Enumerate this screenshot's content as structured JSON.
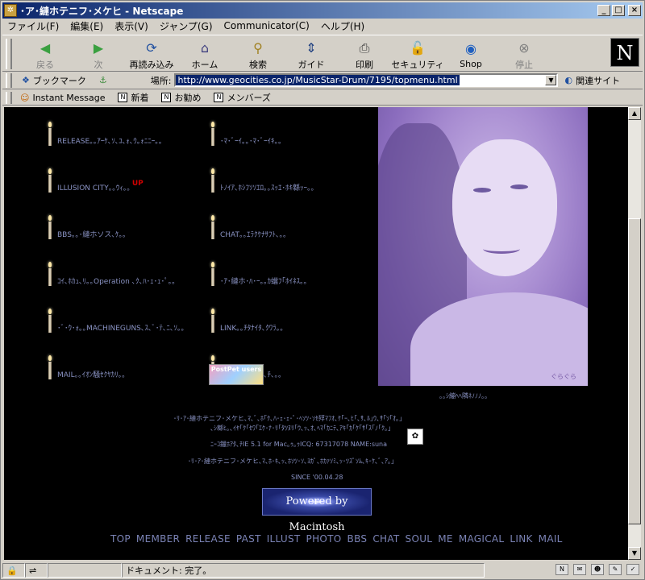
{
  "window": {
    "title": "･ア･縺ホテニフ･メケヒ - Netscape",
    "minimize": "_",
    "maximize": "□",
    "close": "×"
  },
  "menubar": {
    "items": [
      "ファイル(F)",
      "編集(E)",
      "表示(V)",
      "ジャンプ(G)",
      "Communicator(C)",
      "ヘルプ(H)"
    ]
  },
  "navbar": {
    "buttons": [
      {
        "label": "戻る",
        "icon": "back-arrow-icon",
        "glyph": "◀",
        "color": "#3aa040",
        "disabled": true
      },
      {
        "label": "次",
        "icon": "forward-arrow-icon",
        "glyph": "▶",
        "color": "#3aa040",
        "disabled": true
      },
      {
        "label": "再読み込み",
        "icon": "reload-icon",
        "glyph": "⟳",
        "color": "#2050a0",
        "disabled": false
      },
      {
        "label": "ホーム",
        "icon": "home-icon",
        "glyph": "⌂",
        "color": "#404080",
        "disabled": false
      },
      {
        "label": "検索",
        "icon": "search-icon",
        "glyph": "⚲",
        "color": "#a08020",
        "disabled": false
      },
      {
        "label": "ガイド",
        "icon": "guide-icon",
        "glyph": "⇕",
        "color": "#204080",
        "disabled": false
      },
      {
        "label": "印刷",
        "icon": "print-icon",
        "glyph": "⎙",
        "color": "#404040",
        "disabled": false
      },
      {
        "label": "セキュリティ",
        "icon": "security-lock-icon",
        "glyph": "🔓",
        "color": "#a04020",
        "disabled": false
      },
      {
        "label": "Shop",
        "icon": "shop-icon",
        "glyph": "◉",
        "color": "#2060c0",
        "disabled": false
      },
      {
        "label": "停止",
        "icon": "stop-icon",
        "glyph": "⊗",
        "color": "#808080",
        "disabled": true
      }
    ],
    "logo": "N"
  },
  "locbar": {
    "bookmarks_label": "ブックマーク",
    "location_label": "場所:",
    "url": "http://www.geocities.co.jp/MusicStar-Drum/7195/topmenu.html",
    "related_label": "関連サイト"
  },
  "personal_bar": {
    "items": [
      "Instant Message",
      "新着",
      "お勧め",
      "メンバーズ"
    ]
  },
  "content": {
    "links_left": [
      {
        "text": "RELEASE｡｡ｱｰｹ､ｿ､ﾕ､ｫ､ｳ｡ｫﾆﾆｰ｡｡",
        "up": false
      },
      {
        "text": "ILLUSION CITY｡｡ｳｨ｡｡",
        "up": true
      },
      {
        "text": "BBS｡｡･縺ホソス､ｹ｡｡",
        "up": false
      },
      {
        "text": "ｺｲ､ﾎｶｭ､ﾘ｡｡Operation ､ｸ､ﾊ･ｪ･ｪ･ﾟ｡｡",
        "up": false
      },
      {
        "text": "･ﾞ･ｳ･ｫ｡｡MACHINEGUNS､ｽ､ﾞ･ﾃ､ﾆ､ｿ｡｡",
        "up": false
      },
      {
        "text": "MAIL｡｡ｲｵﾝ騒ｾｸﾔｶﾘ｡｡",
        "up": false
      }
    ],
    "links_right": [
      {
        "text": "･ﾏ･ﾞｰｲ｡｡･ﾏ･ﾞｰｲｷ｡｡"
      },
      {
        "text": "ﾄﾉｲｱ､ﾎｼﾌｿｿｴﾛ｡｡ｽｯｴ･ﾎｷ緜ｯｰ｡｡"
      },
      {
        "text": "CHAT｡｡ｴﾗｸｹﾅｻﾌﾄ､｡｡"
      },
      {
        "text": "･ｱ･縺ホ･ﾊ･ｰ｡｡ｶ蟷ﾌ｢ﾎｲﾈｽ｡｡"
      },
      {
        "text": "LINK｡｡ﾁﾀﾅｲﾀ､ｸﾜﾗ｡｡"
      },
      {
        "text": "｡｡･ｿ･ｸ･ｹ･ﾏ､ｳ､ﾁ､｡｡"
      }
    ],
    "up_badge": "UP",
    "postpet_label": "PostPet users",
    "portrait_signature": "ぐらぐら",
    "portrait_caption": "｡｡ｼ繃ﾍﾍ隣ﾈﾉﾉﾉ｡｡",
    "info_lines": [
      "･ﾘ･ｱ･縺ホテニフ･メケヒ､ﾏ､ﾞ､ﾎ｢ｸ､ﾊ･ｪ･ｪ･ﾟ･ﾍｿﾂ･ｿｾ殍ﾏﾌｵ､ｹ｢ｰ､ﾋ｢､ｻ､ﾙ｣ｳ､ｻ｢ｿ｢ｵ｡｣",
      "､ｼ緜ﾋ｡､ｲﾔ｢ｸ｢ｾﾜ｢ｴｹ･ﾅ･ﾘ｢ﾀﾂﾇﾘ｢ｳ､ｯ､ｵ､ﾍﾏ｢ｶﾆﾃ､ｱｷ｢ｶ｢ｹ｢ｻ｢ｽ｢ﾉ｢ｸ｡｣",
      "ﾆｰｺ鑞ﾎｱﾀ､ﾁIE 5.1  for Mac｡ｩ｡ｩICQ: 67317078 NAME:suna",
      "･ﾘ･ｱ･縺ホテニフ･メケヒ､ﾏ､ﾎ･ｷ､ｯ､ﾎｿﾂ･ｿ､ﾖｶﾟ､ﾎｶｧｿﾐ､ｯ･ﾂｽﾟｿﾑ､ｷ･ｹ､ﾞ､ｱ｡｣",
      "SINCE '00.04.28"
    ],
    "powered_label": "Powered by Macintosh",
    "bottom_nav": [
      "TOP",
      "MEMBER",
      "RELEASE",
      "PAST",
      "ILLUST",
      "PHOTO",
      "BBS",
      "CHAT",
      "SOUL",
      "ME",
      "MAGICAL",
      "LINK",
      "MAIL"
    ]
  },
  "statusbar": {
    "status_text": "ドキュメント: 完了。"
  }
}
